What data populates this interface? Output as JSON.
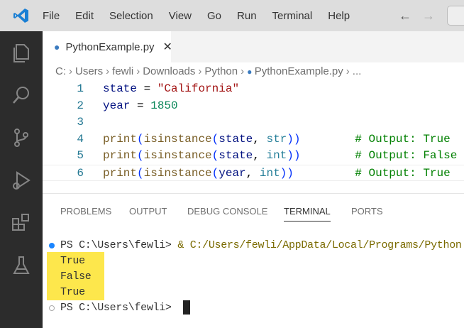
{
  "menu": [
    "File",
    "Edit",
    "Selection",
    "View",
    "Go",
    "Run",
    "Terminal",
    "Help"
  ],
  "tab": {
    "filename": "PythonExample.py"
  },
  "breadcrumb": [
    "C:",
    "Users",
    "fewli",
    "Downloads",
    "Python",
    "PythonExample.py",
    "..."
  ],
  "code": [
    {
      "n": "1",
      "parts": [
        [
          "v",
          "state"
        ],
        [
          "o",
          " = "
        ],
        [
          "s",
          "\"California\""
        ]
      ]
    },
    {
      "n": "2",
      "parts": [
        [
          "v",
          "year"
        ],
        [
          "o",
          " = "
        ],
        [
          "n",
          "1850"
        ]
      ]
    },
    {
      "n": "3",
      "parts": []
    },
    {
      "n": "4",
      "parts": [
        [
          "f",
          "print"
        ],
        [
          "p",
          "("
        ],
        [
          "f",
          "isinstance"
        ],
        [
          "p",
          "("
        ],
        [
          "v",
          "state"
        ],
        [
          "o",
          ", "
        ],
        [
          "t",
          "str"
        ],
        [
          "p",
          "))"
        ],
        [
          "o",
          "        "
        ],
        [
          "c",
          "# Output: True"
        ]
      ]
    },
    {
      "n": "5",
      "parts": [
        [
          "f",
          "print"
        ],
        [
          "p",
          "("
        ],
        [
          "f",
          "isinstance"
        ],
        [
          "p",
          "("
        ],
        [
          "v",
          "state"
        ],
        [
          "o",
          ", "
        ],
        [
          "t",
          "int"
        ],
        [
          "p",
          "))"
        ],
        [
          "o",
          "        "
        ],
        [
          "c",
          "# Output: False"
        ]
      ]
    },
    {
      "n": "6",
      "parts": [
        [
          "f",
          "print"
        ],
        [
          "p",
          "("
        ],
        [
          "f",
          "isinstance"
        ],
        [
          "p",
          "("
        ],
        [
          "v",
          "year"
        ],
        [
          "o",
          ", "
        ],
        [
          "t",
          "int"
        ],
        [
          "p",
          "))"
        ],
        [
          "o",
          "         "
        ],
        [
          "c",
          "# Output: True"
        ]
      ]
    }
  ],
  "panel_tabs": [
    "PROBLEMS",
    "OUTPUT",
    "DEBUG CONSOLE",
    "TERMINAL",
    "PORTS"
  ],
  "active_panel_tab": "TERMINAL",
  "terminal": {
    "prompt": "PS C:\\Users\\fewli> ",
    "command": "& C:/Users/fewli/AppData/Local/Programs/Python",
    "output": [
      "True",
      "False",
      "True"
    ]
  },
  "colors": {
    "highlight": "#fde74c",
    "activity_bar": "#2c2c2c",
    "status_dot": "#1a85ff"
  }
}
